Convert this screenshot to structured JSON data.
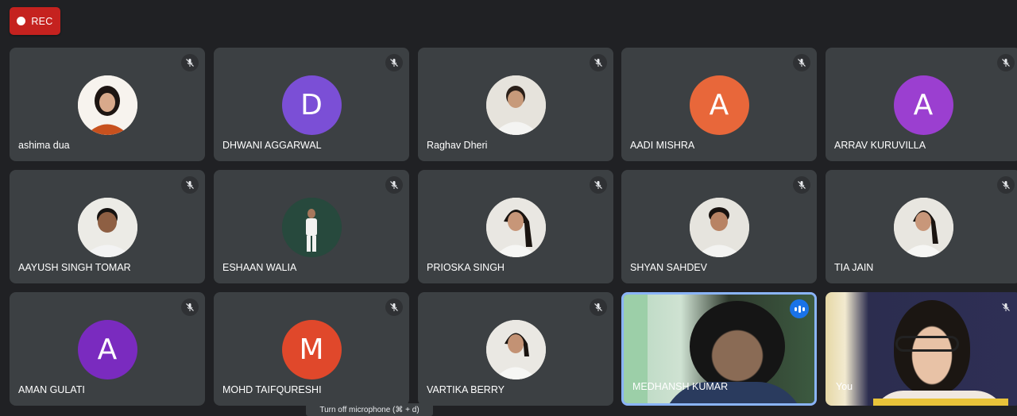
{
  "recording": {
    "label": "REC"
  },
  "participants": [
    {
      "name": "ashima dua",
      "avatar_type": "photo"
    },
    {
      "name": "DHWANI AGGARWAL",
      "initial": "D",
      "avatar_color": "#7b4fd6"
    },
    {
      "name": "Raghav Dheri",
      "avatar_type": "photo"
    },
    {
      "name": "AADI MISHRA",
      "initial": "A",
      "avatar_color": "#e8673a"
    },
    {
      "name": "ARRAV KURUVILLA",
      "initial": "A",
      "avatar_color": "#9b3fd0"
    },
    {
      "name": "AAYUSH SINGH TOMAR",
      "avatar_type": "photo"
    },
    {
      "name": "ESHAAN WALIA",
      "avatar_type": "photo"
    },
    {
      "name": "PRIOSKA SINGH",
      "avatar_type": "photo"
    },
    {
      "name": "SHYAN SAHDEV",
      "avatar_type": "photo"
    },
    {
      "name": "TIA JAIN",
      "avatar_type": "photo"
    },
    {
      "name": "AMAN GULATI",
      "initial": "A",
      "avatar_color": "#7a2bbf"
    },
    {
      "name": "MOHD TAIFQURESHI",
      "initial": "M",
      "avatar_color": "#e0482b"
    },
    {
      "name": "VARTIKA BERRY",
      "avatar_type": "photo"
    },
    {
      "name": "MEDHANSH KUMAR",
      "avatar_type": "video",
      "speaking": true
    },
    {
      "name": "You",
      "avatar_type": "video"
    }
  ],
  "tooltip": {
    "text": "Turn off microphone (⌘ + d)"
  },
  "icons": {
    "muted": "mic-off-icon",
    "speaking": "audio-level-icon"
  }
}
